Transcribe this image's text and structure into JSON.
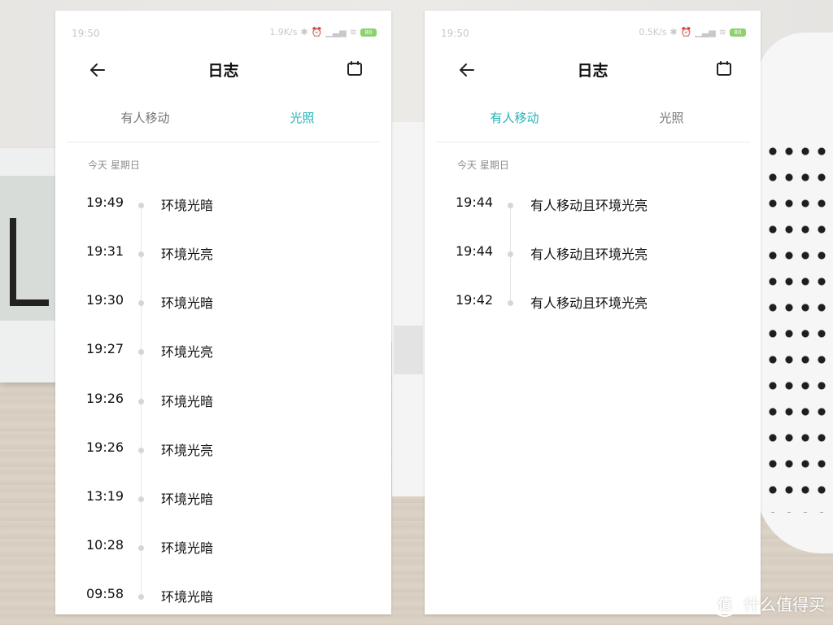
{
  "left_screen": {
    "status": {
      "time": "19:50",
      "speed": "1.9K/s",
      "battery": "80"
    },
    "title": "日志",
    "tabs": [
      {
        "label": "有人移动",
        "active": false
      },
      {
        "label": "光照",
        "active": true
      }
    ],
    "date_label": "今天 星期日",
    "entries": [
      {
        "time": "19:49",
        "event": "环境光暗"
      },
      {
        "time": "19:31",
        "event": "环境光亮"
      },
      {
        "time": "19:30",
        "event": "环境光暗"
      },
      {
        "time": "19:27",
        "event": "环境光亮"
      },
      {
        "time": "19:26",
        "event": "环境光暗"
      },
      {
        "time": "19:26",
        "event": "环境光亮"
      },
      {
        "time": "13:19",
        "event": "环境光暗"
      },
      {
        "time": "10:28",
        "event": "环境光暗"
      },
      {
        "time": "09:58",
        "event": "环境光暗"
      }
    ]
  },
  "right_screen": {
    "status": {
      "time": "19:50",
      "speed": "0.5K/s",
      "battery": "80"
    },
    "title": "日志",
    "tabs": [
      {
        "label": "有人移动",
        "active": true
      },
      {
        "label": "光照",
        "active": false
      }
    ],
    "date_label": "今天 星期日",
    "entries": [
      {
        "time": "19:44",
        "event": "有人移动且环境光亮"
      },
      {
        "time": "19:44",
        "event": "有人移动且环境光亮"
      },
      {
        "time": "19:42",
        "event": "有人移动且环境光亮"
      }
    ]
  },
  "watermark": {
    "text": "什么值得买",
    "logo": "值"
  },
  "colors": {
    "accent": "#26b3b8",
    "text": "#111111",
    "muted": "#8d8d8d",
    "dot": "#d6d6d6"
  },
  "icons": {
    "back": "arrow-left-icon",
    "calendar": "calendar-icon"
  }
}
